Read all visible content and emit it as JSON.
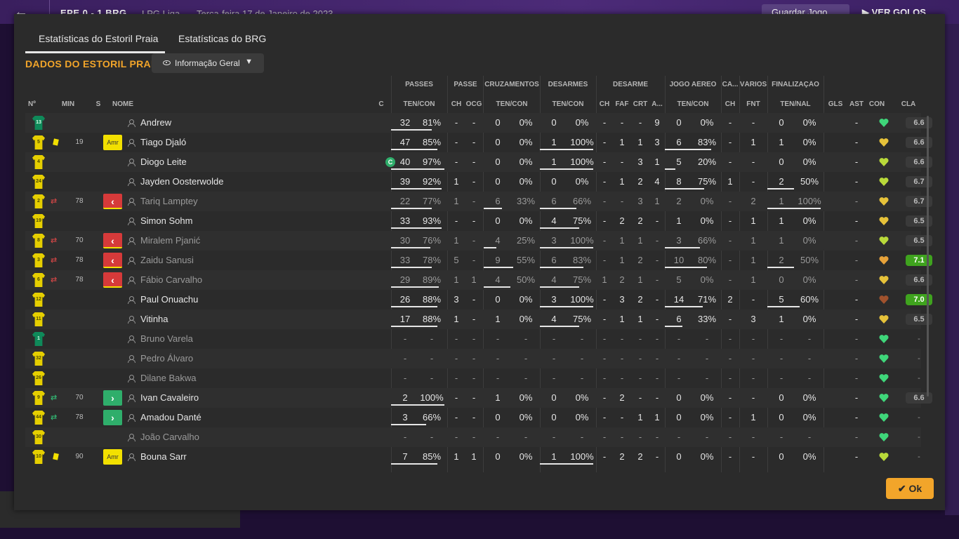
{
  "topbar": {
    "score": "EPE  0 - 1  BRG",
    "league": "LPG Liga",
    "date": "Terça-feira 17 de Janeiro de 2023",
    "save_label": "Guardar Jogo",
    "goals_label": "VER GOLOS"
  },
  "tabs": [
    "Estatísticas do Estoril Praia",
    "Estatísticas do BRG"
  ],
  "section_title": "DADOS DO ESTORIL PRAIA",
  "view_dropdown": "Informação Geral",
  "group_headers": [
    "PASSES",
    "PASSE",
    "CRUZAMENTOS",
    "DESARMES",
    "DESARME",
    "JOGO AÉREO",
    "CA...",
    "VÁRIOS",
    "FINALIZAÇÃO"
  ],
  "columns": [
    "Nº",
    "MIN",
    "S",
    "NOME",
    "C",
    "TEN/CON",
    "CH",
    "OCG",
    "TEN/CON",
    "TEN/CON",
    "CH",
    "FAF",
    "CRT",
    "A...",
    "TEN/CON",
    "CH",
    "FNT",
    "TEN/NAL",
    "GLS",
    "AST",
    "CON",
    "CLA"
  ],
  "colors": {
    "accent": "#f2a52a",
    "yellow_card": "#f2e000",
    "sub_out": "#d63a3a",
    "sub_in": "#2fae6b",
    "rating_good": "#3fa31e"
  },
  "players": [
    {
      "num": "13",
      "gk": true,
      "min": "",
      "card": false,
      "sub": "",
      "badge": "",
      "name": "Andrew",
      "cap": false,
      "dim": false,
      "v": [
        "32",
        "81%",
        "-",
        "-",
        "0",
        "0%",
        "0",
        "0%",
        "-",
        "-",
        "-",
        "9",
        "0",
        "0%",
        "-",
        "-",
        "0",
        "0%",
        "",
        "-"
      ],
      "morale": "green",
      "rating": "6.6",
      "rgood": false,
      "bars": [
        [
          0,
          58
        ],
        [
          4,
          0
        ],
        [
          5,
          0
        ],
        [
          8,
          0
        ],
        [
          10,
          0
        ]
      ]
    },
    {
      "num": "5",
      "gk": false,
      "min": "19",
      "card": true,
      "sub": "",
      "badge": "amr",
      "name": "Tiago Djaló",
      "cap": false,
      "dim": false,
      "v": [
        "47",
        "85%",
        "-",
        "-",
        "0",
        "0%",
        "1",
        "100%",
        "-",
        "1",
        "1",
        "3",
        "6",
        "83%",
        "-",
        "1",
        "1",
        "0%",
        "",
        "-"
      ],
      "morale": "yellow",
      "rating": "6.6",
      "rgood": false,
      "bars": [
        [
          0,
          66
        ],
        [
          4,
          0
        ],
        [
          5,
          76
        ],
        [
          8,
          66
        ],
        [
          10,
          0
        ]
      ]
    },
    {
      "num": "4",
      "gk": false,
      "min": "",
      "card": false,
      "sub": "",
      "badge": "",
      "name": "Diogo Leite",
      "cap": true,
      "dim": false,
      "v": [
        "40",
        "97%",
        "-",
        "-",
        "0",
        "0%",
        "1",
        "100%",
        "-",
        "-",
        "3",
        "1",
        "5",
        "20%",
        "-",
        "-",
        "0",
        "0%",
        "",
        "-"
      ],
      "morale": "lime",
      "rating": "6.6",
      "rgood": false,
      "bars": [
        [
          0,
          76
        ],
        [
          4,
          0
        ],
        [
          5,
          76
        ],
        [
          8,
          15
        ],
        [
          10,
          0
        ]
      ]
    },
    {
      "num": "24",
      "gk": false,
      "min": "",
      "card": false,
      "sub": "",
      "badge": "",
      "name": "Jayden Oosterwolde",
      "cap": false,
      "dim": false,
      "v": [
        "39",
        "92%",
        "1",
        "-",
        "0",
        "0%",
        "0",
        "0%",
        "-",
        "1",
        "2",
        "4",
        "8",
        "75%",
        "1",
        "-",
        "2",
        "50%",
        "",
        "-"
      ],
      "morale": "lime",
      "rating": "6.7",
      "rgood": false,
      "bars": [
        [
          0,
          72
        ],
        [
          4,
          0
        ],
        [
          5,
          0
        ],
        [
          8,
          56
        ],
        [
          10,
          38
        ]
      ]
    },
    {
      "num": "2",
      "gk": false,
      "min": "78",
      "card": false,
      "sub": "out",
      "badge": "out",
      "name": "Tariq Lamptey",
      "cap": false,
      "dim": true,
      "v": [
        "22",
        "77%",
        "1",
        "-",
        "6",
        "33%",
        "6",
        "66%",
        "-",
        "-",
        "3",
        "1",
        "2",
        "0%",
        "-",
        "2",
        "1",
        "100%",
        "",
        "-"
      ],
      "morale": "yellow",
      "rating": "6.7",
      "rgood": false,
      "bars": [
        [
          0,
          58
        ],
        [
          4,
          26
        ],
        [
          5,
          52
        ],
        [
          8,
          0
        ],
        [
          10,
          76
        ]
      ]
    },
    {
      "num": "19",
      "gk": false,
      "min": "",
      "card": false,
      "sub": "",
      "badge": "",
      "name": "Simon Sohm",
      "cap": false,
      "dim": false,
      "v": [
        "33",
        "93%",
        "-",
        "-",
        "0",
        "0%",
        "4",
        "75%",
        "-",
        "2",
        "2",
        "-",
        "1",
        "0%",
        "-",
        "1",
        "1",
        "0%",
        "",
        "-"
      ],
      "morale": "yellow",
      "rating": "6.5",
      "rgood": false,
      "bars": [
        [
          0,
          72
        ],
        [
          4,
          0
        ],
        [
          5,
          56
        ],
        [
          8,
          0
        ],
        [
          10,
          0
        ]
      ]
    },
    {
      "num": "8",
      "gk": false,
      "min": "70",
      "card": false,
      "sub": "out",
      "badge": "out",
      "name": "Miralem Pjanić",
      "cap": false,
      "dim": true,
      "v": [
        "30",
        "76%",
        "1",
        "-",
        "4",
        "25%",
        "3",
        "100%",
        "-",
        "1",
        "1",
        "-",
        "3",
        "66%",
        "-",
        "1",
        "1",
        "0%",
        "",
        "-"
      ],
      "morale": "lime",
      "rating": "6.5",
      "rgood": false,
      "bars": [
        [
          0,
          56
        ],
        [
          4,
          18
        ],
        [
          5,
          76
        ],
        [
          8,
          50
        ],
        [
          10,
          0
        ]
      ]
    },
    {
      "num": "3",
      "gk": false,
      "min": "78",
      "card": false,
      "sub": "out",
      "badge": "out",
      "name": "Zaidu Sanusi",
      "cap": false,
      "dim": true,
      "v": [
        "33",
        "78%",
        "5",
        "-",
        "9",
        "55%",
        "6",
        "83%",
        "-",
        "1",
        "2",
        "-",
        "10",
        "80%",
        "-",
        "1",
        "2",
        "50%",
        "",
        "-"
      ],
      "morale": "orange",
      "rating": "7.1",
      "rgood": true,
      "bars": [
        [
          0,
          58
        ],
        [
          4,
          42
        ],
        [
          5,
          62
        ],
        [
          8,
          60
        ],
        [
          10,
          38
        ]
      ]
    },
    {
      "num": "6",
      "gk": false,
      "min": "78",
      "card": false,
      "sub": "out",
      "badge": "out",
      "name": "Fábio Carvalho",
      "cap": false,
      "dim": true,
      "v": [
        "29",
        "89%",
        "1",
        "1",
        "4",
        "50%",
        "4",
        "75%",
        "1",
        "2",
        "1",
        "-",
        "5",
        "0%",
        "-",
        "1",
        "0",
        "0%",
        "",
        "-"
      ],
      "morale": "yellow",
      "rating": "6.6",
      "rgood": false,
      "bars": [
        [
          0,
          68
        ],
        [
          4,
          38
        ],
        [
          5,
          56
        ],
        [
          8,
          0
        ],
        [
          10,
          0
        ]
      ]
    },
    {
      "num": "12",
      "gk": false,
      "min": "",
      "card": false,
      "sub": "",
      "badge": "",
      "name": "Paul Onuachu",
      "cap": false,
      "dim": false,
      "v": [
        "26",
        "88%",
        "3",
        "-",
        "0",
        "0%",
        "3",
        "100%",
        "-",
        "3",
        "2",
        "-",
        "14",
        "71%",
        "2",
        "-",
        "5",
        "60%",
        "",
        "-"
      ],
      "morale": "brown",
      "rating": "7.0",
      "rgood": true,
      "bars": [
        [
          0,
          66
        ],
        [
          4,
          0
        ],
        [
          5,
          76
        ],
        [
          8,
          54
        ],
        [
          10,
          46
        ]
      ]
    },
    {
      "num": "11",
      "gk": false,
      "min": "",
      "card": false,
      "sub": "",
      "badge": "",
      "name": "Vitinha",
      "cap": false,
      "dim": false,
      "v": [
        "17",
        "88%",
        "1",
        "-",
        "1",
        "0%",
        "4",
        "75%",
        "-",
        "1",
        "1",
        "-",
        "6",
        "33%",
        "-",
        "3",
        "1",
        "0%",
        "",
        "-"
      ],
      "morale": "yellow",
      "rating": "6.5",
      "rgood": false,
      "bars": [
        [
          0,
          66
        ],
        [
          4,
          0
        ],
        [
          5,
          56
        ],
        [
          8,
          25
        ],
        [
          10,
          0
        ]
      ]
    },
    {
      "num": "1",
      "gk": true,
      "min": "",
      "card": false,
      "sub": "",
      "badge": "",
      "name": "Bruno Varela",
      "cap": false,
      "dim": true,
      "v": [
        "-",
        "-",
        "-",
        "-",
        "-",
        "-",
        "-",
        "-",
        "-",
        "-",
        "-",
        "-",
        "-",
        "-",
        "-",
        "-",
        "-",
        "-",
        "",
        "-"
      ],
      "morale": "green",
      "rating": "-",
      "rgood": false,
      "none": true,
      "bars": []
    },
    {
      "num": "32",
      "gk": false,
      "min": "",
      "card": false,
      "sub": "",
      "badge": "",
      "name": "Pedro Álvaro",
      "cap": false,
      "dim": true,
      "v": [
        "-",
        "-",
        "-",
        "-",
        "-",
        "-",
        "-",
        "-",
        "-",
        "-",
        "-",
        "-",
        "-",
        "-",
        "-",
        "-",
        "-",
        "-",
        "",
        "-"
      ],
      "morale": "green",
      "rating": "-",
      "rgood": false,
      "none": true,
      "bars": []
    },
    {
      "num": "26",
      "gk": false,
      "min": "",
      "card": false,
      "sub": "",
      "badge": "",
      "name": "Dilane Bakwa",
      "cap": false,
      "dim": true,
      "v": [
        "-",
        "-",
        "-",
        "-",
        "-",
        "-",
        "-",
        "-",
        "-",
        "-",
        "-",
        "-",
        "-",
        "-",
        "-",
        "-",
        "-",
        "-",
        "",
        "-"
      ],
      "morale": "green",
      "rating": "-",
      "rgood": false,
      "none": true,
      "bars": []
    },
    {
      "num": "9",
      "gk": false,
      "min": "70",
      "card": false,
      "sub": "in",
      "badge": "in",
      "name": "Ivan Cavaleiro",
      "cap": false,
      "dim": false,
      "v": [
        "2",
        "100%",
        "-",
        "-",
        "1",
        "0%",
        "0",
        "0%",
        "-",
        "2",
        "-",
        "-",
        "0",
        "0%",
        "-",
        "-",
        "0",
        "0%",
        "",
        "-"
      ],
      "morale": "green",
      "rating": "6.6",
      "rgood": false,
      "bars": [
        [
          0,
          76
        ],
        [
          4,
          0
        ],
        [
          5,
          0
        ],
        [
          8,
          0
        ],
        [
          10,
          0
        ]
      ]
    },
    {
      "num": "44",
      "gk": false,
      "min": "78",
      "card": false,
      "sub": "in",
      "badge": "in",
      "name": "Amadou Danté",
      "cap": false,
      "dim": false,
      "v": [
        "3",
        "66%",
        "-",
        "-",
        "0",
        "0%",
        "0",
        "0%",
        "-",
        "-",
        "1",
        "1",
        "0",
        "0%",
        "-",
        "1",
        "0",
        "0%",
        "",
        "-"
      ],
      "morale": "green",
      "rating": "-",
      "rgood": false,
      "none": true,
      "bars": [
        [
          0,
          50
        ],
        [
          4,
          0
        ],
        [
          5,
          0
        ],
        [
          8,
          0
        ],
        [
          10,
          0
        ]
      ]
    },
    {
      "num": "30",
      "gk": false,
      "min": "",
      "card": false,
      "sub": "",
      "badge": "",
      "name": "João Carvalho",
      "cap": false,
      "dim": true,
      "v": [
        "-",
        "-",
        "-",
        "-",
        "-",
        "-",
        "-",
        "-",
        "-",
        "-",
        "-",
        "-",
        "-",
        "-",
        "-",
        "-",
        "-",
        "-",
        "",
        "-"
      ],
      "morale": "green",
      "rating": "-",
      "rgood": false,
      "none": true,
      "bars": []
    },
    {
      "num": "10",
      "gk": false,
      "min": "90",
      "card": true,
      "sub": "",
      "badge": "amr",
      "name": "Bouna Sarr",
      "cap": false,
      "dim": false,
      "v": [
        "7",
        "85%",
        "1",
        "1",
        "0",
        "0%",
        "1",
        "100%",
        "-",
        "2",
        "2",
        "-",
        "0",
        "0%",
        "-",
        "-",
        "0",
        "0%",
        "",
        "-"
      ],
      "morale": "lime",
      "rating": "-",
      "rgood": false,
      "none": true,
      "bars": [
        [
          0,
          66
        ],
        [
          4,
          0
        ],
        [
          5,
          76
        ],
        [
          8,
          0
        ],
        [
          10,
          0
        ]
      ]
    }
  ],
  "badge_amr": "Amr",
  "cap_letter": "C",
  "ok_label": "Ok"
}
